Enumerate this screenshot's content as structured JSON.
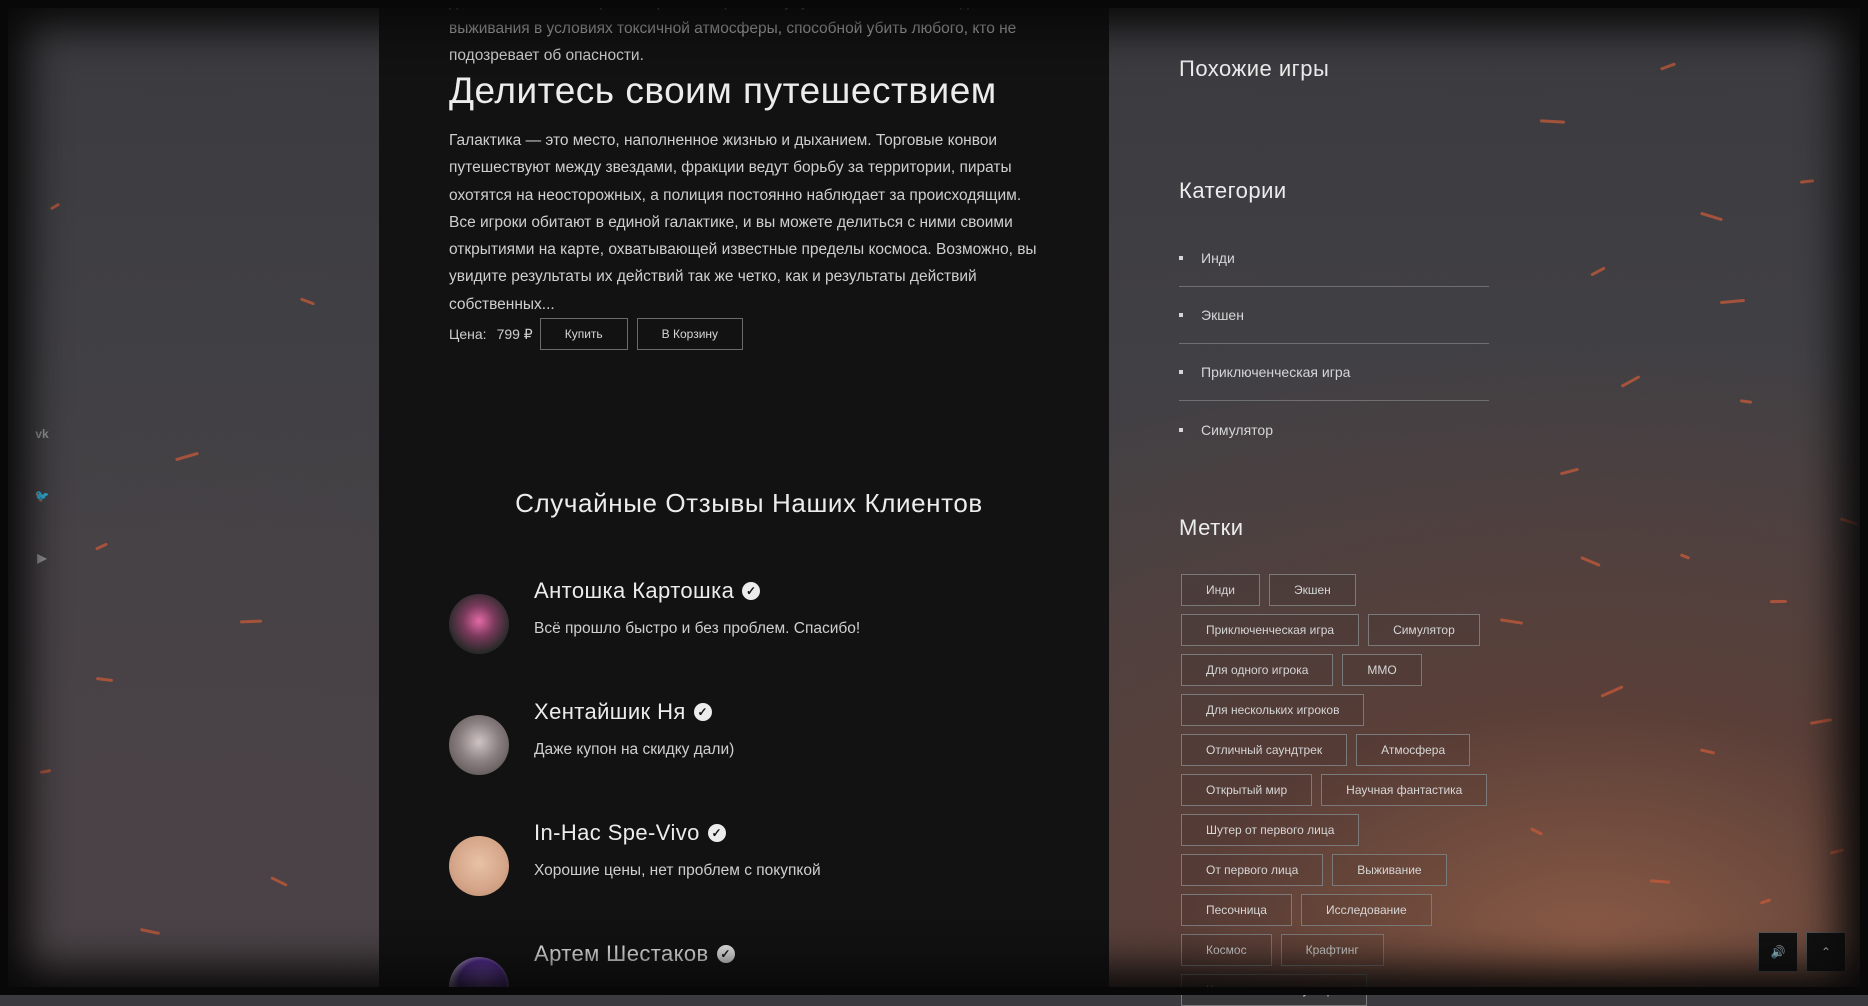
{
  "colors": {
    "panel": "#121212",
    "accent": "#ececec",
    "spark": "#c65a3a"
  },
  "social": [
    {
      "name": "vk-icon",
      "glyph": "vk"
    },
    {
      "name": "twitter-icon",
      "glyph": "🐦"
    },
    {
      "name": "youtube-icon",
      "glyph": "▶"
    }
  ],
  "main": {
    "top_text": "для того, чтобы совершить прыжки к цели, вы улучшаете свой костюм для выживания в условиях токсичной атмосферы, способной убить любого, кто не подозревает об опасности.",
    "share_title": "Делитесь своим путешествием",
    "description": "Галактика — это место, наполненное жизнью и дыханием. Торговые конвои путешествуют между звездами, фракции ведут борьбу за территории, пираты охотятся на неосторожных, а полиция постоянно наблюдает за происходящим. Все игроки обитают в единой галактике, и вы можете делиться с ними своими открытиями на карте, охватывающей известные пределы космоса. Возможно, вы увидите результаты их действий так же четко, как и результаты действий собственных...",
    "price_label": "Цена:",
    "price_value": "799 ₽",
    "buy_label": "Купить",
    "cart_label": "В Корзину",
    "reviews_title": "Случайные Отзывы Наших Клиентов",
    "reviews": [
      {
        "name": "Антошка Картошка",
        "text": "Всё прошло быстро и без проблем. Спасибо!"
      },
      {
        "name": "Хентайшик Ня",
        "text": "Даже купон на скидку дали)"
      },
      {
        "name": "In-Нас Spe-Vivo",
        "text": "Хорошие цены, нет проблем с покупкой"
      },
      {
        "name": "Артем Шестаков",
        "text": ""
      }
    ]
  },
  "sidebar": {
    "similar_title": "Похожие игры",
    "categories_title": "Категории",
    "categories": [
      "Инди",
      "Экшен",
      "Приключенческая игра",
      "Симулятор"
    ],
    "tags_title": "Метки",
    "tags": [
      "Инди",
      "Экшен",
      "Приключенческая игра",
      "Симулятор",
      "Для одного игрока",
      "MMO",
      "Для нескольких игроков",
      "Отличный саундтрек",
      "Атмосфера",
      "Открытый мир",
      "Научная фантастика",
      "Шутер от первого лица",
      "От первого лица",
      "Выживание",
      "Песочница",
      "Исследование",
      "Космос",
      "Крафтинг",
      "Космическая симуляция"
    ]
  },
  "corner": {
    "sound_icon": "🔊",
    "up_icon": "⌃"
  }
}
